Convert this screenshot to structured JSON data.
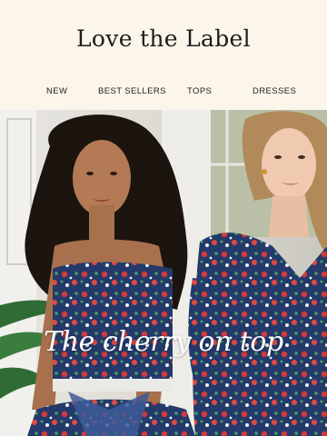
{
  "brand": {
    "logo_text": "Love the Label"
  },
  "nav": {
    "items": [
      {
        "label": "NEW"
      },
      {
        "label": "BEST SELLERS"
      },
      {
        "label": "TOPS"
      },
      {
        "label": "DRESSES"
      }
    ]
  },
  "hero": {
    "tagline": "The cherry on top",
    "image": "two models wearing navy cherry-print smocked tops and dresses"
  }
}
